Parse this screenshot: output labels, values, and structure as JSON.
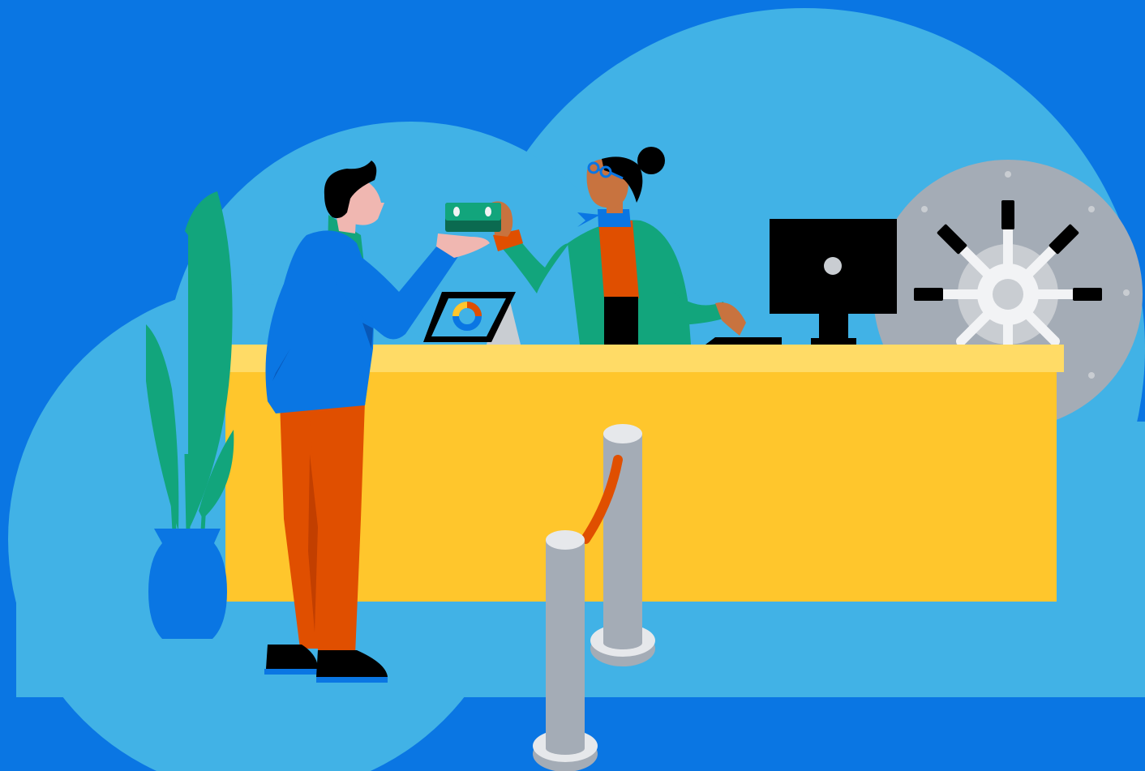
{
  "scene": {
    "subject": "bank-teller-transaction",
    "colors": {
      "background": "#0a76e3",
      "cloud": "#41b2e6",
      "desk_top": "#ffdb66",
      "desk_front": "#ffc62c",
      "vault": "#a4acb6",
      "vault_light": "#c9cdd2",
      "vault_spoke": "#f2f3f5",
      "plant": "#12a57c",
      "pot": "#0a76e3",
      "customer_jacket": "#0a76e3",
      "customer_pants": "#e04f00",
      "teller_cardigan": "#12a57c",
      "teller_shirt": "#e04f00",
      "skin_customer": "#f0b7b1",
      "skin_teller": "#c8733f",
      "cash": "#12a57c",
      "post": "#a4acb6",
      "post_cap": "#e6e8eb",
      "rope": "#e04f00",
      "black": "#000000"
    },
    "icons": [
      "plant-icon",
      "customer-icon",
      "teller-icon",
      "cash-icon",
      "tablet-icon",
      "monitor-icon",
      "vault-door-icon",
      "queue-post-icon"
    ]
  }
}
